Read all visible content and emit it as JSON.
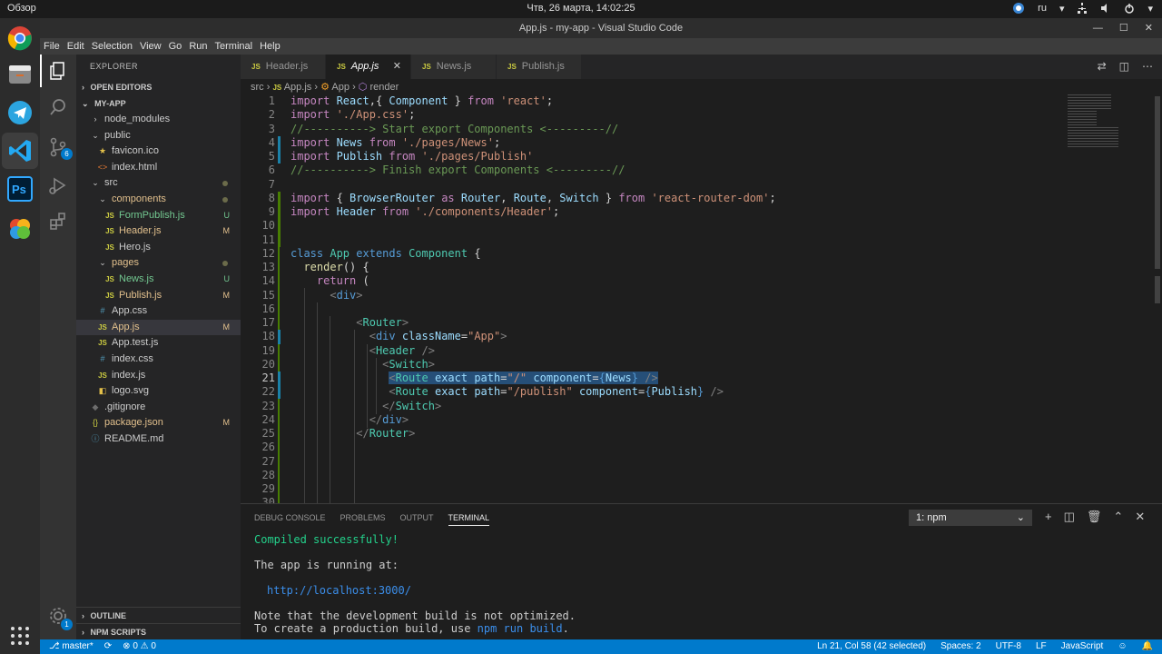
{
  "system_bar": {
    "activities": "Обзор",
    "datetime": "Чтв, 26 марта, 14:02:25",
    "language": "ru"
  },
  "window": {
    "title": "App.js - my-app - Visual Studio Code"
  },
  "menu": [
    "File",
    "Edit",
    "Selection",
    "View",
    "Go",
    "Run",
    "Terminal",
    "Help"
  ],
  "dock_icons": [
    "chrome-icon",
    "files-icon",
    "telegram-icon",
    "vscode-icon",
    "photoshop-icon",
    "app-icon",
    "apps-grid-icon"
  ],
  "activity_bar": {
    "source_control_badge": "6",
    "settings_badge": "1"
  },
  "explorer": {
    "header": "EXPLORER",
    "open_editors": "OPEN EDITORS",
    "project": "MY-APP",
    "outline": "OUTLINE",
    "npm_scripts": "NPM SCRIPTS",
    "items": [
      {
        "name": "node_modules",
        "type": "folder",
        "depth": 1,
        "icon": "chevron-right"
      },
      {
        "name": "public",
        "type": "folder",
        "depth": 1,
        "icon": "chevron-down"
      },
      {
        "name": "favicon.ico",
        "type": "file",
        "depth": 2,
        "icon": "star",
        "color": "#e3c04a"
      },
      {
        "name": "index.html",
        "type": "file",
        "depth": 2,
        "icon": "html",
        "color": "#e37933"
      },
      {
        "name": "src",
        "type": "folder",
        "depth": 1,
        "icon": "chevron-down",
        "dot": true
      },
      {
        "name": "components",
        "type": "folder",
        "depth": 2,
        "icon": "chevron-down",
        "dot": true,
        "text_color": "#e2c08d"
      },
      {
        "name": "FormPublish.js",
        "type": "file",
        "depth": 3,
        "icon": "js",
        "badge": "U",
        "text_color": "#73c991",
        "badge_color": "#73c991"
      },
      {
        "name": "Header.js",
        "type": "file",
        "depth": 3,
        "icon": "js",
        "badge": "M",
        "text_color": "#e2c08d",
        "badge_color": "#e2c08d"
      },
      {
        "name": "Hero.js",
        "type": "file",
        "depth": 3,
        "icon": "js"
      },
      {
        "name": "pages",
        "type": "folder",
        "depth": 2,
        "icon": "chevron-down",
        "dot": true,
        "text_color": "#e2c08d"
      },
      {
        "name": "News.js",
        "type": "file",
        "depth": 3,
        "icon": "js",
        "badge": "U",
        "text_color": "#73c991",
        "badge_color": "#73c991"
      },
      {
        "name": "Publish.js",
        "type": "file",
        "depth": 3,
        "icon": "js",
        "badge": "M",
        "text_color": "#e2c08d",
        "badge_color": "#e2c08d"
      },
      {
        "name": "App.css",
        "type": "file",
        "depth": 2,
        "icon": "hash",
        "color": "#519aba"
      },
      {
        "name": "App.js",
        "type": "file",
        "depth": 2,
        "icon": "js",
        "badge": "M",
        "text_color": "#e2c08d",
        "badge_color": "#e2c08d",
        "selected": true
      },
      {
        "name": "App.test.js",
        "type": "file",
        "depth": 2,
        "icon": "js"
      },
      {
        "name": "index.css",
        "type": "file",
        "depth": 2,
        "icon": "hash",
        "color": "#519aba"
      },
      {
        "name": "index.js",
        "type": "file",
        "depth": 2,
        "icon": "js"
      },
      {
        "name": "logo.svg",
        "type": "file",
        "depth": 2,
        "icon": "svg",
        "color": "#e3c04a"
      },
      {
        "name": ".gitignore",
        "type": "file",
        "depth": 1,
        "icon": "git",
        "color": "#6d6d6d"
      },
      {
        "name": "package.json",
        "type": "file",
        "depth": 1,
        "icon": "braces",
        "badge": "M",
        "text_color": "#e2c08d",
        "badge_color": "#e2c08d",
        "color": "#cbcb41"
      },
      {
        "name": "README.md",
        "type": "file",
        "depth": 1,
        "icon": "info",
        "color": "#519aba"
      }
    ]
  },
  "tabs": [
    {
      "label": "Header.js",
      "active": false
    },
    {
      "label": "App.js",
      "active": true
    },
    {
      "label": "News.js",
      "active": false
    },
    {
      "label": "Publish.js",
      "active": false
    }
  ],
  "breadcrumb": [
    "src",
    "App.js",
    "App",
    "render"
  ],
  "editor": {
    "lines": [
      [
        [
          "k",
          "import "
        ],
        [
          "v",
          "React"
        ],
        [
          "",
          ","
        ],
        [
          "",
          "{ "
        ],
        [
          "v",
          "Component"
        ],
        [
          "",
          " } "
        ],
        [
          "k",
          "from "
        ],
        [
          "s",
          "'react'"
        ],
        [
          "",
          ";"
        ]
      ],
      [
        [
          "k",
          "import "
        ],
        [
          "s",
          "'./App.css'"
        ],
        [
          "",
          ";"
        ]
      ],
      [
        [
          "c",
          "//----------> Start export Components <---------//"
        ]
      ],
      [
        [
          "k",
          "import "
        ],
        [
          "v",
          "News "
        ],
        [
          "k",
          "from "
        ],
        [
          "s",
          "'./pages/News'"
        ],
        [
          "",
          ";"
        ]
      ],
      [
        [
          "k",
          "import "
        ],
        [
          "v",
          "Publish "
        ],
        [
          "k",
          "from "
        ],
        [
          "s",
          "'./pages/Publish'"
        ]
      ],
      [
        [
          "c",
          "//----------> Finish export Components <---------//"
        ]
      ],
      [],
      [
        [
          "k",
          "import "
        ],
        [
          "",
          "{ "
        ],
        [
          "v",
          "BrowserRouter "
        ],
        [
          "k",
          "as "
        ],
        [
          "v",
          "Router"
        ],
        [
          "",
          ", "
        ],
        [
          "v",
          "Route"
        ],
        [
          "",
          ", "
        ],
        [
          "v",
          "Switch"
        ],
        [
          "",
          " } "
        ],
        [
          "k",
          "from "
        ],
        [
          "s",
          "'react-router-dom'"
        ],
        [
          "",
          ";"
        ]
      ],
      [
        [
          "k",
          "import "
        ],
        [
          "v",
          "Header "
        ],
        [
          "k",
          "from "
        ],
        [
          "s",
          "'./components/Header'"
        ],
        [
          "",
          ";"
        ]
      ],
      [],
      [],
      [
        [
          "kw",
          "class "
        ],
        [
          "t",
          "App "
        ],
        [
          "kw",
          "extends "
        ],
        [
          "t",
          "Component "
        ],
        [
          "",
          "{"
        ]
      ],
      [
        [
          "",
          "  "
        ],
        [
          "f",
          "render"
        ],
        [
          "",
          "() {"
        ]
      ],
      [
        [
          "",
          "    "
        ],
        [
          "k",
          "return "
        ],
        [
          "",
          "("
        ]
      ],
      [
        [
          "",
          "      "
        ],
        [
          "g",
          "<"
        ],
        [
          "tg",
          "div"
        ],
        [
          "g",
          ">"
        ]
      ],
      [],
      [
        [
          "",
          "          "
        ],
        [
          "g",
          "<"
        ],
        [
          "t",
          "Router"
        ],
        [
          "g",
          ">"
        ]
      ],
      [
        [
          "",
          "            "
        ],
        [
          "g",
          "<"
        ],
        [
          "tg",
          "div "
        ],
        [
          "v",
          "className"
        ],
        [
          "",
          "="
        ],
        [
          "s",
          "\"App\""
        ],
        [
          "g",
          ">"
        ]
      ],
      [
        [
          "",
          "            "
        ],
        [
          "g",
          "<"
        ],
        [
          "t",
          "Header "
        ],
        [
          "g",
          "/>"
        ]
      ],
      [
        [
          "",
          "              "
        ],
        [
          "g",
          "<"
        ],
        [
          "t",
          "Switch"
        ],
        [
          "g",
          ">"
        ]
      ],
      [
        [
          "",
          "               "
        ],
        [
          "g",
          "<"
        ],
        [
          "t",
          "Route "
        ],
        [
          "v",
          "exact "
        ],
        [
          "v",
          "path"
        ],
        [
          "",
          "="
        ],
        [
          "s",
          "\"/\" "
        ],
        [
          "v",
          "component"
        ],
        [
          "",
          "="
        ],
        [
          "kw",
          "{"
        ],
        [
          "v",
          "News"
        ],
        [
          "kw",
          "}"
        ],
        [
          "",
          " "
        ],
        [
          "g",
          "/>"
        ]
      ],
      [
        [
          "",
          "               "
        ],
        [
          "g",
          "<"
        ],
        [
          "t",
          "Route "
        ],
        [
          "v",
          "exact "
        ],
        [
          "v",
          "path"
        ],
        [
          "",
          "="
        ],
        [
          "s",
          "\"/publish\" "
        ],
        [
          "v",
          "component"
        ],
        [
          "",
          "="
        ],
        [
          "kw",
          "{"
        ],
        [
          "v",
          "Publish"
        ],
        [
          "kw",
          "}"
        ],
        [
          "",
          " "
        ],
        [
          "g",
          "/>"
        ]
      ],
      [
        [
          "",
          "              "
        ],
        [
          "g",
          "</"
        ],
        [
          "t",
          "Switch"
        ],
        [
          "g",
          ">"
        ]
      ],
      [
        [
          "",
          "            "
        ],
        [
          "g",
          "</"
        ],
        [
          "tg",
          "div"
        ],
        [
          "g",
          ">"
        ]
      ],
      [
        [
          "",
          "          "
        ],
        [
          "g",
          "</"
        ],
        [
          "t",
          "Router"
        ],
        [
          "g",
          ">"
        ]
      ],
      [],
      [],
      [],
      [],
      []
    ],
    "line_numbers": [
      "1",
      "2",
      "3",
      "4",
      "5",
      "6",
      "7",
      "8",
      "9",
      "10",
      "11",
      "12",
      "13",
      "14",
      "15",
      "16",
      "17",
      "18",
      "19",
      "20",
      "21",
      "22",
      "23",
      "24",
      "25",
      "26",
      "27",
      "28",
      "29",
      "30"
    ],
    "current_line": "21"
  },
  "panel": {
    "tabs": [
      "DEBUG CONSOLE",
      "PROBLEMS",
      "OUTPUT",
      "TERMINAL"
    ],
    "active_tab": "TERMINAL",
    "terminal_select": "1: npm",
    "terminal": {
      "compiled": "Compiled successfully!",
      "running": "The app is running at:",
      "url": "http://localhost:3000/",
      "note": "Note that the development build is not optimized.",
      "prod_prefix": "To create a production build, use ",
      "prod_cmd": "npm run build",
      "prod_suffix": "."
    }
  },
  "statusbar": {
    "branch": "master*",
    "sync": "⟳",
    "errors": "⊗ 0 ⚠ 0",
    "position": "Ln 21, Col 58 (42 selected)",
    "spaces": "Spaces: 2",
    "encoding": "UTF-8",
    "eol": "LF",
    "language": "JavaScript"
  },
  "colors": {
    "accent": "#007acc",
    "sidebar": "#252526",
    "editor_bg": "#1e1e1e",
    "modified": "#e2c08d",
    "untracked": "#73c991"
  }
}
